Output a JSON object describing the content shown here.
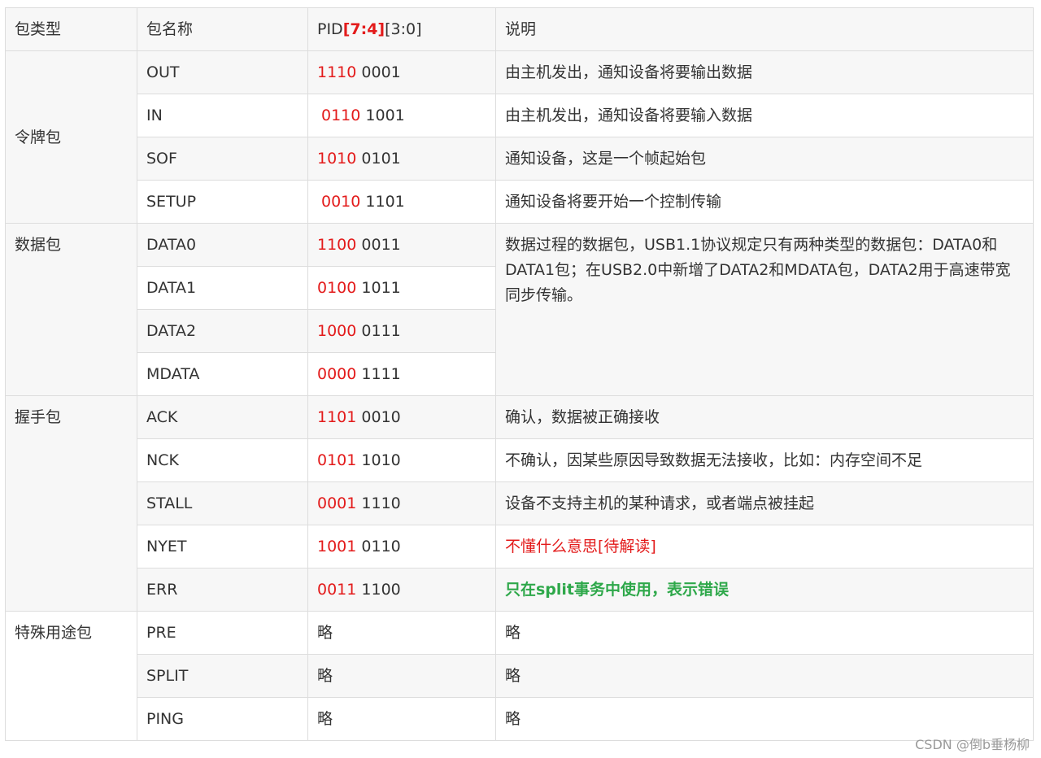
{
  "header": {
    "col1": "包类型",
    "col2": "包名称",
    "col3_prefix": "PID",
    "col3_hi": "[7:4]",
    "col3_lo": "[3:0]",
    "col4": "说明"
  },
  "groups": {
    "token": "令牌包",
    "data": "数据包",
    "handshake": "握手包",
    "special": "特殊用途包"
  },
  "rows": [
    {
      "name": "OUT",
      "pid_hi": "1110",
      "pid_lo": "0001",
      "desc": "由主机发出，通知设备将要输出数据"
    },
    {
      "name": "IN",
      "pid_hi": "0110",
      "pid_lo": "1001",
      "desc": "由主机发出，通知设备将要输入数据"
    },
    {
      "name": "SOF",
      "pid_hi": "1010",
      "pid_lo": "0101",
      "desc": "通知设备，这是一个帧起始包"
    },
    {
      "name": "SETUP",
      "pid_hi": "0010",
      "pid_lo": "1101",
      "desc": "通知设备将要开始一个控制传输"
    },
    {
      "name": "DATA0",
      "pid_hi": "1100",
      "pid_lo": "0011",
      "desc": "数据过程的数据包，USB1.1协议规定只有两种类型的数据包：DATA0和DATA1包；在USB2.0中新增了DATA2和MDATA包，DATA2用于高速带宽同步传输。"
    },
    {
      "name": "DATA1",
      "pid_hi": "0100",
      "pid_lo": "1011"
    },
    {
      "name": "DATA2",
      "pid_hi": "1000",
      "pid_lo": "0111"
    },
    {
      "name": "MDATA",
      "pid_hi": "0000",
      "pid_lo": "1111"
    },
    {
      "name": "ACK",
      "pid_hi": "1101",
      "pid_lo": "0010",
      "desc": "确认，数据被正确接收"
    },
    {
      "name": "NCK",
      "pid_hi": "0101",
      "pid_lo": "1010",
      "desc": "不确认，因某些原因导致数据无法接收，比如：内存空间不足"
    },
    {
      "name": "STALL",
      "pid_hi": "0001",
      "pid_lo": "1110",
      "desc": "设备不支持主机的某种请求，或者端点被挂起"
    },
    {
      "name": "NYET",
      "pid_hi": "1001",
      "pid_lo": "0110",
      "desc": "不懂什么意思[待解读]"
    },
    {
      "name": "ERR",
      "pid_hi": "0011",
      "pid_lo": "1100",
      "desc": "只在split事务中使用，表示错误"
    },
    {
      "name": "PRE",
      "pid": "略",
      "desc": "略"
    },
    {
      "name": "SPLIT",
      "pid": "略",
      "desc": "略"
    },
    {
      "name": "PING",
      "pid": "略",
      "desc": "略"
    }
  ],
  "watermark": "CSDN @倒b垂杨柳",
  "colors": {
    "pid_highlight": "#e31b1b",
    "nyet_text": "#e31b1b",
    "err_text": "#2ea84a",
    "header_bg": "#f7f7f7",
    "border": "#dddddd"
  }
}
